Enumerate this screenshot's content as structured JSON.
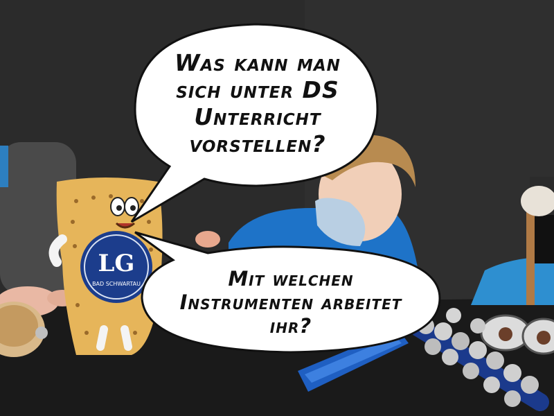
{
  "speech_bubbles": [
    {
      "lines": [
        "Was kann man",
        "sich unter DS",
        "Unterricht",
        "vorstellen?"
      ]
    },
    {
      "lines": [
        "Mit welchen",
        "Instrumenten arbeitet",
        "ihr?"
      ]
    }
  ],
  "mascot_logo": {
    "initials": "LG",
    "town": "BAD SCHWARTAU"
  },
  "colors": {
    "background": "#2a2a2a",
    "bubble_fill": "#ffffff",
    "bubble_outline": "#111111",
    "cracker": "#e6b55a",
    "shirt_blue": "#1e73c8",
    "case_blue": "#1f5fc2"
  }
}
